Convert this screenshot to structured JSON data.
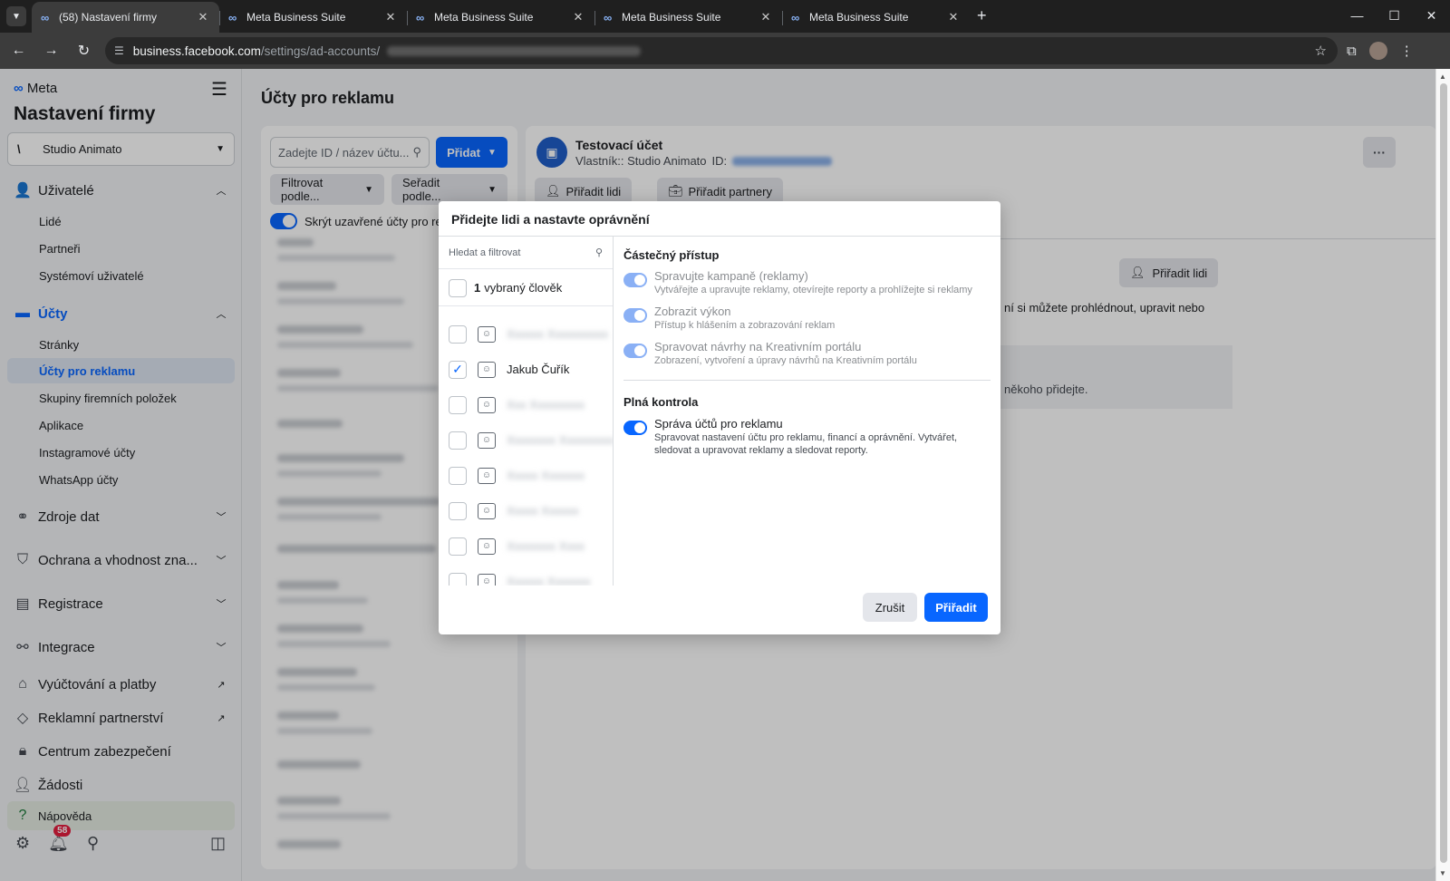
{
  "browser": {
    "tabs": [
      {
        "title": "(58) Nastavení firmy",
        "active": true
      },
      {
        "title": "Meta Business Suite",
        "active": false
      },
      {
        "title": "Meta Business Suite",
        "active": false
      },
      {
        "title": "Meta Business Suite",
        "active": false
      },
      {
        "title": "Meta Business Suite",
        "active": false
      }
    ],
    "url_host": "business.facebook.com",
    "url_path": "/settings/ad-accounts/"
  },
  "sidebar": {
    "brand": "Meta",
    "title": "Nastavení firmy",
    "business": "Studio Animato",
    "users_section": "Uživatelé",
    "users_items": [
      "Lidé",
      "Partneři",
      "Systémoví uživatelé"
    ],
    "accounts_section": "Účty",
    "accounts_items": [
      "Stránky",
      "Účty pro reklamu",
      "Skupiny firemních položek",
      "Aplikace",
      "Instagramové účty",
      "WhatsApp účty"
    ],
    "data_sources": "Zdroje dat",
    "brand_safety": "Ochrana a vhodnost zna...",
    "registration": "Registrace",
    "integrations": "Integrace",
    "billing": "Vyúčtování a platby",
    "ad_partnerships": "Reklamní partnerství",
    "security_center": "Centrum zabezpečení",
    "requests": "Žádosti",
    "help": "Nápověda",
    "notifications_count": "58"
  },
  "main": {
    "title": "Účty pro reklamu",
    "search_placeholder": "Zadejte ID / název účtu...",
    "add_button": "Přidat",
    "filter_button": "Filtrovat podle...",
    "sort_button": "Seřadit podle...",
    "hide_closed_toggle": "Skrýt uzavřené účty pro reklamu"
  },
  "detail": {
    "account_name": "Testovací účet",
    "owner_label": "Vlastník:: Studio Animato",
    "id_label": "ID:",
    "assign_people": "Přiřadit lidi",
    "assign_partners": "Přiřadit partnery",
    "assign_people_2": "Přiřadit lidi",
    "text_fragment": "ní si můžete prohlédnout, upravit nebo",
    "grey_fragment": "někoho přidejte."
  },
  "modal": {
    "title": "Přidejte lidi a nastavte oprávnění",
    "search_placeholder": "Hledat a filtrovat",
    "selected_count": "1",
    "selected_label": "vybraný člověk",
    "checked_person": "Jakub Čuřík",
    "partial_access": "Částečný přístup",
    "perm1_title": "Spravujte kampaně (reklamy)",
    "perm1_desc": "Vytvářejte a upravujte reklamy, otevírejte reporty a prohlížejte si reklamy",
    "perm2_title": "Zobrazit výkon",
    "perm2_desc": "Přístup k hlášením a zobrazování reklam",
    "perm3_title": "Spravovat návrhy na Kreativním portálu",
    "perm3_desc": "Zobrazení, vytvoření a úpravy návrhů na Kreativním portálu",
    "full_control": "Plná kontrola",
    "perm4_title": "Správa účtů pro reklamu",
    "perm4_desc": "Spravovat nastavení účtu pro reklamu, financí a oprávnění. Vytvářet, sledovat a upravovat reklamy a sledovat reporty.",
    "cancel": "Zrušit",
    "assign": "Přiřadit"
  }
}
